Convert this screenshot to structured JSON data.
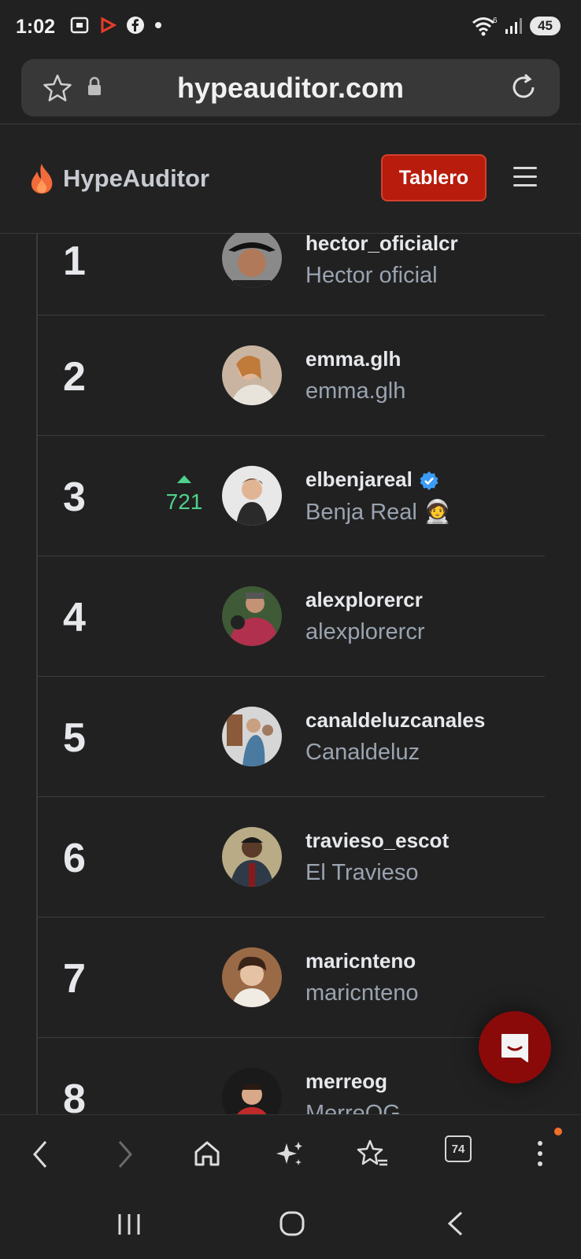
{
  "status_bar": {
    "time": "1:02",
    "battery": "45",
    "wifi_badge": "6"
  },
  "browser": {
    "url": "hypeauditor.com",
    "tabs_count": "74"
  },
  "site": {
    "brand": "HypeAuditor",
    "dashboard_button": "Tablero"
  },
  "rankings": [
    {
      "rank": "1",
      "username": "hector_oficialcr",
      "display_name": "Hector oficial",
      "change": "",
      "verified": false
    },
    {
      "rank": "2",
      "username": "emma.glh",
      "display_name": "emma.glh",
      "change": "",
      "verified": false
    },
    {
      "rank": "3",
      "username": "elbenjareal",
      "display_name": "Benja Real 🧑‍🚀",
      "change": "721",
      "verified": true
    },
    {
      "rank": "4",
      "username": "alexplorercr",
      "display_name": "alexplorercr",
      "change": "",
      "verified": false
    },
    {
      "rank": "5",
      "username": "canaldeluzcanales",
      "display_name": "Canaldeluz",
      "change": "",
      "verified": false
    },
    {
      "rank": "6",
      "username": "travieso_escot",
      "display_name": "El Travieso",
      "change": "",
      "verified": false
    },
    {
      "rank": "7",
      "username": "maricnteno",
      "display_name": "maricnteno",
      "change": "",
      "verified": false
    },
    {
      "rank": "8",
      "username": "merreog",
      "display_name": "MerreOG",
      "change": "",
      "verified": false
    }
  ],
  "colors": {
    "accent": "#b71c0c",
    "up_change": "#4fd18b",
    "verified": "#3b9cf5"
  }
}
